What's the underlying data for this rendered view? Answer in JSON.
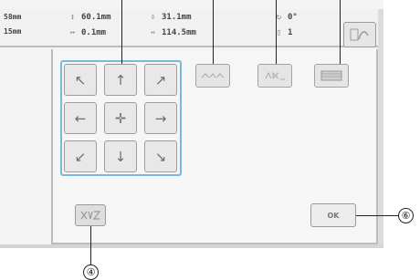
{
  "status": {
    "height_value": "58mm",
    "width_value": "15mm",
    "stats": [
      {
        "icon": "↕",
        "value": "60.1mm"
      },
      {
        "icon": "↔",
        "value": "0.1mm"
      },
      {
        "icon": "⇕",
        "value": "31.1mm"
      },
      {
        "icon": "⇿",
        "value": "114.5mm"
      },
      {
        "icon": "↻",
        "value": "0°"
      },
      {
        "icon": "▯",
        "value": "1"
      }
    ]
  },
  "arrows": [
    {
      "name": "arrow-up-left",
      "glyph": "↖"
    },
    {
      "name": "arrow-up",
      "glyph": "↑"
    },
    {
      "name": "arrow-up-right",
      "glyph": "↗"
    },
    {
      "name": "arrow-left",
      "glyph": "←"
    },
    {
      "name": "arrow-center",
      "glyph": "✛"
    },
    {
      "name": "arrow-right",
      "glyph": "→"
    },
    {
      "name": "arrow-down-left",
      "glyph": "↙"
    },
    {
      "name": "arrow-down",
      "glyph": "↓"
    },
    {
      "name": "arrow-down-right",
      "glyph": "↘"
    }
  ],
  "ok_button": {
    "label": "OK"
  },
  "callouts": {
    "four": "④",
    "six": "⑥"
  },
  "colors": {
    "frame_highlight": "#79b9df"
  }
}
